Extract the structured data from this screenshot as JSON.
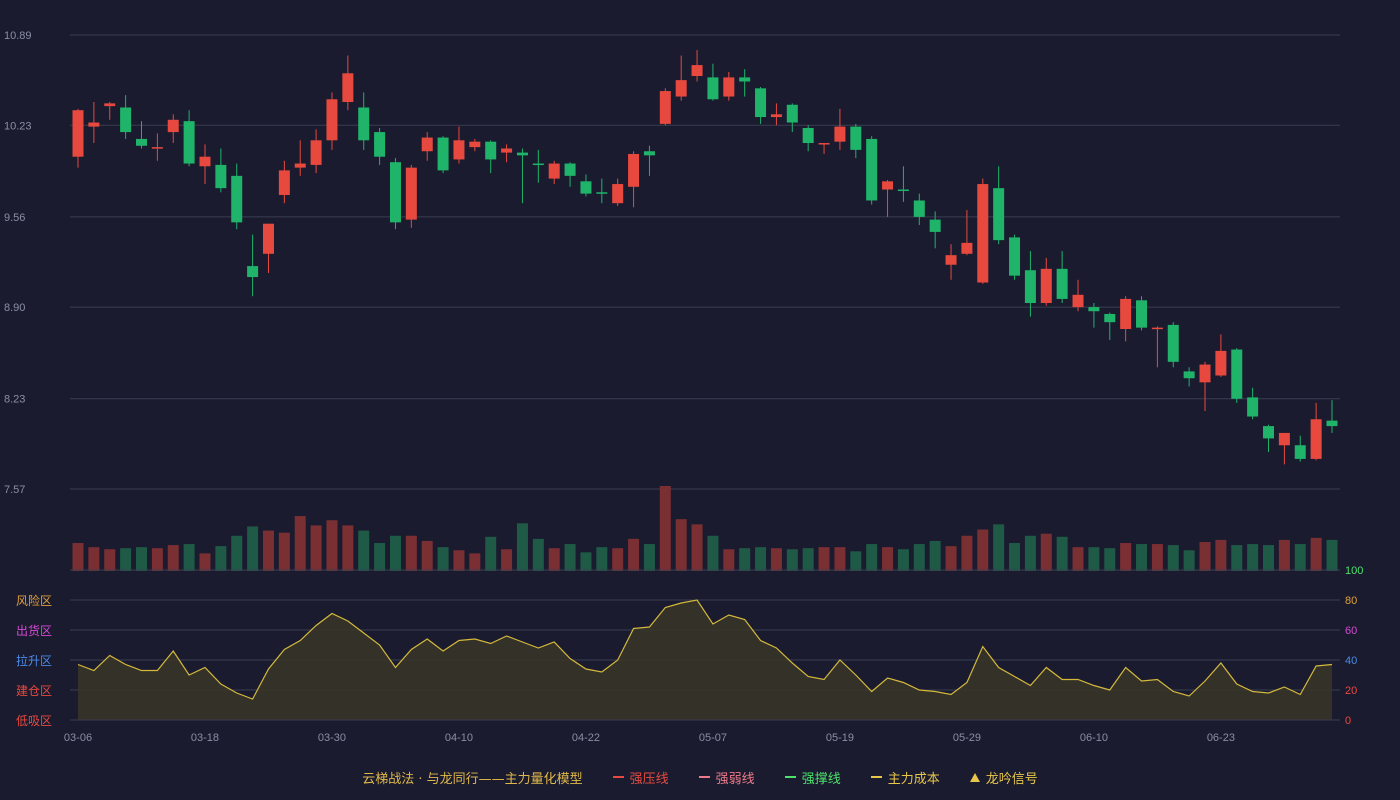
{
  "colors": {
    "background": "#1a1b2e",
    "up": "#e8493f",
    "down": "#1fb46a",
    "volume_up": "#7a2f33",
    "volume_down": "#1e5a46",
    "grid": "#3a3c52",
    "axis_text": "#8a8fa3",
    "cost_line": "#d4b93c",
    "cost_fill": "#3a3527"
  },
  "legend": {
    "title": "云梯战法 · 与龙同行——主力量化模型",
    "items": [
      {
        "label": "强压线",
        "color": "#e8493f",
        "style": "line"
      },
      {
        "label": "强弱线",
        "color": "#f07a8a",
        "style": "dash"
      },
      {
        "label": "强撑线",
        "color": "#4be36a",
        "style": "line"
      },
      {
        "label": "主力成本",
        "color": "#e8c64a",
        "style": "dash"
      },
      {
        "label": "龙吟信号",
        "color": "#e8c64a",
        "style": "triangle"
      }
    ]
  },
  "zones": [
    {
      "label": "风险区",
      "color": "#e0a03a"
    },
    {
      "label": "出货区",
      "color": "#d44ad4"
    },
    {
      "label": "拉升区",
      "color": "#4a8ae8"
    },
    {
      "label": "建仓区",
      "color": "#e8493f"
    },
    {
      "label": "低吸区",
      "color": "#e8493f"
    }
  ],
  "chart_data": {
    "type": "candlestick",
    "price_ticks": [
      "10.89",
      "10.23",
      "9.56",
      "8.90",
      "8.23",
      "7.57"
    ],
    "price_range": [
      7.57,
      10.89
    ],
    "indicator_ticks": [
      {
        "label": "100",
        "color": "#4be36a"
      },
      {
        "label": "80",
        "color": "#e0a03a"
      },
      {
        "label": "60",
        "color": "#d44ad4"
      },
      {
        "label": "40",
        "color": "#4a8ae8"
      },
      {
        "label": "20",
        "color": "#e8493f"
      },
      {
        "label": "0",
        "color": "#e8493f"
      }
    ],
    "indicator_range": [
      0,
      100
    ],
    "x_ticks": [
      {
        "index": 0,
        "label": "03-06"
      },
      {
        "index": 8,
        "label": "03-18"
      },
      {
        "index": 16,
        "label": "03-30"
      },
      {
        "index": 24,
        "label": "04-10"
      },
      {
        "index": 32,
        "label": "04-22"
      },
      {
        "index": 40,
        "label": "05-07"
      },
      {
        "index": 48,
        "label": "05-19"
      },
      {
        "index": 56,
        "label": "05-29"
      },
      {
        "index": 64,
        "label": "06-10"
      },
      {
        "index": 72,
        "label": "06-23"
      }
    ],
    "ohlc": [
      [
        10.0,
        10.34,
        9.92,
        10.35
      ],
      [
        10.22,
        10.25,
        10.1,
        10.4
      ],
      [
        10.37,
        10.39,
        10.27,
        10.4
      ],
      [
        10.36,
        10.18,
        10.13,
        10.45
      ],
      [
        10.13,
        10.08,
        10.06,
        10.26
      ],
      [
        10.06,
        10.07,
        9.97,
        10.17
      ],
      [
        10.18,
        10.27,
        10.1,
        10.31
      ],
      [
        10.26,
        9.95,
        9.93,
        10.34
      ],
      [
        9.93,
        10.0,
        9.8,
        10.09
      ],
      [
        9.94,
        9.77,
        9.74,
        10.06
      ],
      [
        9.86,
        9.52,
        9.47,
        9.95
      ],
      [
        9.2,
        9.12,
        8.98,
        9.43
      ],
      [
        9.29,
        9.51,
        9.15,
        9.51
      ],
      [
        9.72,
        9.9,
        9.66,
        9.97
      ],
      [
        9.92,
        9.95,
        9.86,
        10.12
      ],
      [
        9.94,
        10.12,
        9.88,
        10.2
      ],
      [
        10.12,
        10.42,
        10.05,
        10.47
      ],
      [
        10.4,
        10.61,
        10.34,
        10.74
      ],
      [
        10.36,
        10.12,
        10.05,
        10.47
      ],
      [
        10.18,
        10.0,
        9.94,
        10.21
      ],
      [
        9.96,
        9.52,
        9.47,
        9.99
      ],
      [
        9.54,
        9.92,
        9.48,
        9.94
      ],
      [
        10.04,
        10.14,
        9.97,
        10.18
      ],
      [
        10.14,
        9.9,
        9.88,
        10.15
      ],
      [
        9.98,
        10.12,
        9.95,
        10.22
      ],
      [
        10.07,
        10.11,
        10.04,
        10.13
      ],
      [
        10.11,
        9.98,
        9.88,
        10.12
      ],
      [
        10.03,
        10.06,
        9.96,
        10.09
      ],
      [
        10.03,
        10.01,
        9.66,
        10.06
      ],
      [
        9.95,
        9.94,
        9.81,
        10.05
      ],
      [
        9.84,
        9.95,
        9.8,
        9.97
      ],
      [
        9.95,
        9.86,
        9.78,
        9.96
      ],
      [
        9.82,
        9.73,
        9.71,
        9.87
      ],
      [
        9.74,
        9.73,
        9.66,
        9.84
      ],
      [
        9.66,
        9.8,
        9.64,
        9.84
      ],
      [
        9.78,
        10.02,
        9.63,
        10.04
      ],
      [
        10.04,
        10.01,
        9.86,
        10.08
      ],
      [
        10.24,
        10.48,
        10.23,
        10.5
      ],
      [
        10.44,
        10.56,
        10.41,
        10.74
      ],
      [
        10.59,
        10.67,
        10.55,
        10.78
      ],
      [
        10.58,
        10.42,
        10.41,
        10.68
      ],
      [
        10.44,
        10.58,
        10.41,
        10.62
      ],
      [
        10.58,
        10.55,
        10.44,
        10.64
      ],
      [
        10.5,
        10.29,
        10.24,
        10.51
      ],
      [
        10.29,
        10.31,
        10.23,
        10.39
      ],
      [
        10.38,
        10.25,
        10.18,
        10.39
      ],
      [
        10.21,
        10.1,
        10.04,
        10.23
      ],
      [
        10.09,
        10.1,
        10.02,
        10.1
      ],
      [
        10.11,
        10.22,
        10.05,
        10.35
      ],
      [
        10.22,
        10.05,
        9.99,
        10.24
      ],
      [
        10.13,
        9.68,
        9.65,
        10.15
      ],
      [
        9.76,
        9.82,
        9.56,
        9.83
      ],
      [
        9.76,
        9.75,
        9.67,
        9.93
      ],
      [
        9.68,
        9.56,
        9.5,
        9.73
      ],
      [
        9.54,
        9.45,
        9.33,
        9.6
      ],
      [
        9.21,
        9.28,
        9.1,
        9.36
      ],
      [
        9.29,
        9.37,
        9.28,
        9.61
      ],
      [
        9.08,
        9.8,
        9.07,
        9.84
      ],
      [
        9.77,
        9.39,
        9.36,
        9.93
      ],
      [
        9.41,
        9.13,
        9.1,
        9.43
      ],
      [
        9.17,
        8.93,
        8.83,
        9.31
      ],
      [
        8.93,
        9.18,
        8.91,
        9.26
      ],
      [
        9.18,
        8.96,
        8.93,
        9.31
      ],
      [
        8.9,
        8.99,
        8.87,
        9.1
      ],
      [
        8.9,
        8.87,
        8.75,
        8.93
      ],
      [
        8.85,
        8.79,
        8.66,
        8.86
      ],
      [
        8.74,
        8.96,
        8.65,
        8.98
      ],
      [
        8.95,
        8.75,
        8.73,
        8.98
      ],
      [
        8.75,
        8.75,
        8.46,
        8.76
      ],
      [
        8.77,
        8.5,
        8.46,
        8.79
      ],
      [
        8.43,
        8.38,
        8.32,
        8.46
      ],
      [
        8.35,
        8.48,
        8.14,
        8.5
      ],
      [
        8.4,
        8.58,
        8.39,
        8.7
      ],
      [
        8.59,
        8.23,
        8.2,
        8.6
      ],
      [
        8.24,
        8.1,
        8.08,
        8.31
      ],
      [
        8.03,
        7.94,
        7.84,
        8.04
      ],
      [
        7.89,
        7.98,
        7.75,
        7.98
      ],
      [
        7.89,
        7.79,
        7.77,
        7.96
      ],
      [
        7.79,
        8.08,
        7.78,
        8.2
      ],
      [
        8.07,
        8.03,
        7.98,
        8.22
      ]
    ],
    "volume": [
      27,
      23,
      21,
      22,
      23,
      22,
      25,
      26,
      17,
      24,
      34,
      43,
      39,
      37,
      53,
      44,
      49,
      44,
      39,
      27,
      34,
      34,
      29,
      23,
      20,
      17,
      33,
      21,
      46,
      31,
      22,
      26,
      18,
      23,
      22,
      31,
      26,
      82,
      50,
      45,
      34,
      21,
      22,
      23,
      22,
      21,
      22,
      23,
      23,
      19,
      26,
      23,
      21,
      26,
      29,
      24,
      34,
      40,
      45,
      27,
      34,
      36,
      33,
      23,
      23,
      22,
      27,
      26,
      26,
      25,
      20,
      28,
      30,
      25,
      26,
      25,
      30,
      26,
      32,
      30
    ],
    "volume_range": [
      0,
      82
    ],
    "cost": [
      37,
      33,
      43,
      37,
      33,
      33,
      46,
      30,
      35,
      24,
      18,
      14,
      34,
      47,
      53,
      63,
      71,
      66,
      58,
      50,
      35,
      47,
      54,
      46,
      53,
      54,
      51,
      56,
      52,
      48,
      52,
      41,
      34,
      32,
      40,
      61,
      62,
      75,
      78,
      80,
      64,
      70,
      67,
      53,
      48,
      38,
      29,
      27,
      40,
      30,
      19,
      28,
      25,
      20,
      19,
      17,
      25,
      49,
      35,
      29,
      23,
      35,
      27,
      27,
      23,
      20,
      35,
      26,
      27,
      19,
      16,
      26,
      38,
      24,
      19,
      18,
      22,
      17,
      36,
      37
    ]
  }
}
